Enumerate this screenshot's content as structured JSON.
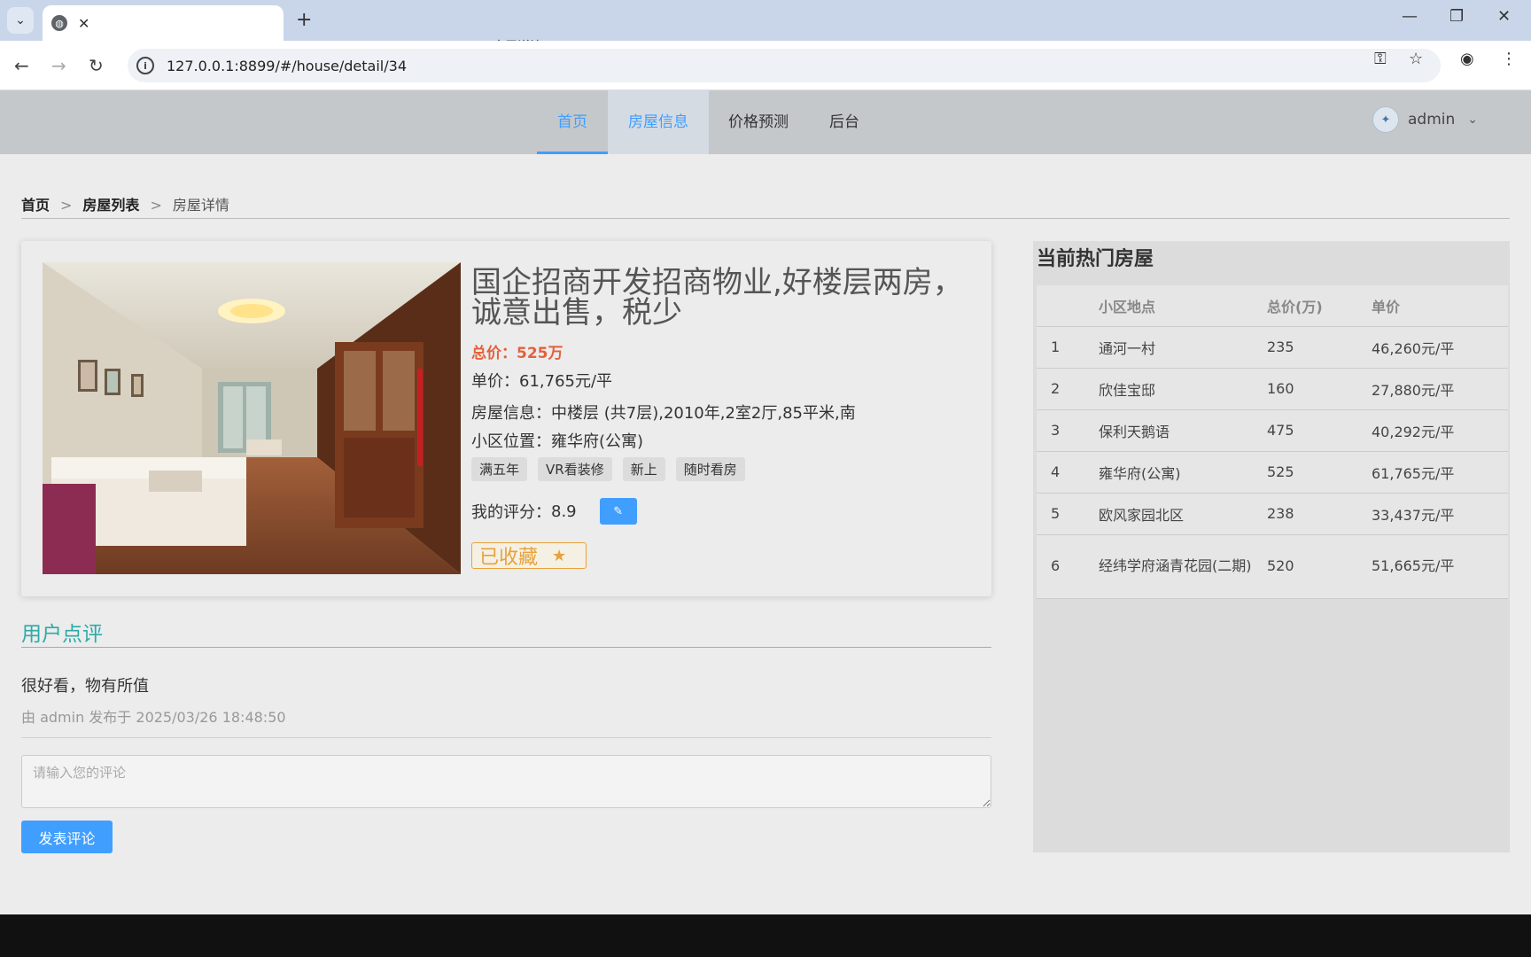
{
  "browser": {
    "tab_title": "房屋详情",
    "url": "127.0.0.1:8899/#/house/detail/34"
  },
  "nav": {
    "items": [
      {
        "label": "首页"
      },
      {
        "label": "房屋信息"
      },
      {
        "label": "价格预测"
      },
      {
        "label": "后台"
      }
    ],
    "user": "admin"
  },
  "breadcrumb": {
    "home": "首页",
    "list": "房屋列表",
    "current": "房屋详情",
    "sep": ">"
  },
  "house": {
    "title": "国企招商开发招商物业,好楼层两房，诚意出售，税少",
    "total_price": "总价：525万",
    "unit_price": "单价：61,765元/平",
    "info": "房屋信息：中楼层 (共7层),2010年,2室2厅,85平米,南",
    "community": "小区位置：雍华府(公寓)",
    "tags": [
      "满五年",
      "VR看装修",
      "新上",
      "随时看房"
    ],
    "rating_label": "我的评分：",
    "rating_value": "8.9",
    "favorited_label": "已收藏"
  },
  "comments": {
    "title": "用户点评",
    "items": [
      {
        "text": "很好看，物有所值",
        "meta": "由 admin 发布于 2025/03/26 18:48:50"
      }
    ],
    "input_placeholder": "请输入您的评论",
    "submit_label": "发表评论"
  },
  "hot": {
    "title": "当前热门房屋",
    "columns": [
      "",
      "小区地点",
      "总价(万)",
      "单价"
    ],
    "rows": [
      {
        "rank": "1",
        "name": "通河一村",
        "total": "235",
        "unit": "46,260元/平"
      },
      {
        "rank": "2",
        "name": "欣佳宝邸",
        "total": "160",
        "unit": "27,880元/平"
      },
      {
        "rank": "3",
        "name": "保利天鹅语",
        "total": "475",
        "unit": "40,292元/平"
      },
      {
        "rank": "4",
        "name": "雍华府(公寓)",
        "total": "525",
        "unit": "61,765元/平"
      },
      {
        "rank": "5",
        "name": "欧风家园北区",
        "total": "238",
        "unit": "33,437元/平"
      },
      {
        "rank": "6",
        "name": "经纬学府涵青花园(二期)",
        "total": "520",
        "unit": "51,665元/平"
      }
    ]
  },
  "colors": {
    "accent": "#409eff",
    "price": "#e2613d",
    "favorite": "#e6a23c",
    "section_title": "#2eaaa8"
  }
}
